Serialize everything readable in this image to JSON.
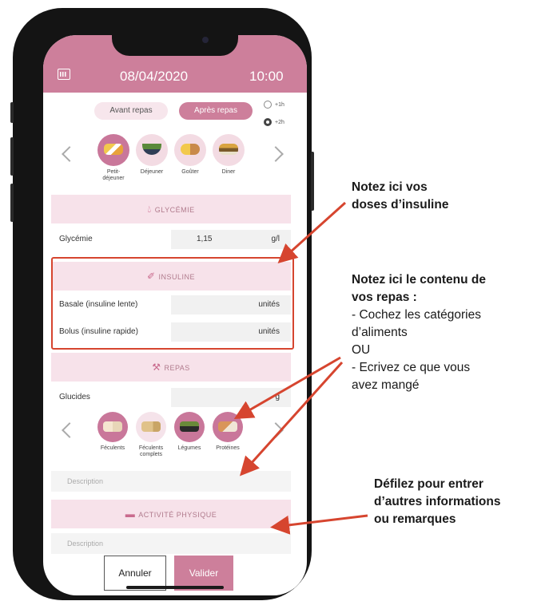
{
  "header": {
    "date": "08/04/2020",
    "time": "10:00"
  },
  "tabs": {
    "before": "Avant repas",
    "after": "Après repas"
  },
  "timing": {
    "opt1": "+1h",
    "opt2": "+2h"
  },
  "meals": [
    {
      "label": "Petit-\ndéjeuner",
      "selected": true
    },
    {
      "label": "Déjeuner",
      "selected": false
    },
    {
      "label": "Goûter",
      "selected": false
    },
    {
      "label": "Diner",
      "selected": false
    }
  ],
  "glycemie": {
    "title": "GLYCÉMIE",
    "label": "Glycémie",
    "value": "1,15",
    "unit": "g/l"
  },
  "insuline": {
    "title": "INSULINE",
    "basal_label": "Basale (insuline lente)",
    "basal_unit": "unités",
    "bolus_label": "Bolus (insuline rapide)",
    "bolus_unit": "unités"
  },
  "repas": {
    "title": "REPAS",
    "glucides_label": "Glucides",
    "glucides_unit": "g",
    "categories": [
      {
        "label": "Féculents",
        "selected": true
      },
      {
        "label": "Féculents\ncomplets",
        "selected": false
      },
      {
        "label": "Légumes",
        "selected": true
      },
      {
        "label": "Protéines",
        "selected": true
      }
    ],
    "description_placeholder": "Description"
  },
  "activite": {
    "title": "ACTIVITÉ PHYSIQUE",
    "description_placeholder": "Description"
  },
  "buttons": {
    "cancel": "Annuler",
    "ok": "Valider"
  },
  "annotations": {
    "insulin": [
      "Notez ici vos",
      "doses d’insuline"
    ],
    "repas_title": [
      "Notez ici le contenu de",
      "vos repas :"
    ],
    "repas_body": [
      "- Cochez les catégories",
      "d’aliments",
      "OU",
      "- Ecrivez ce que vous",
      "avez mangé"
    ],
    "scroll": [
      "Défilez pour entrer",
      "d’autres informations",
      "ou remarques"
    ]
  },
  "colors": {
    "accent": "#cd7f9b",
    "accent_light": "#f7e2ea",
    "annotation": "#d6452f"
  }
}
